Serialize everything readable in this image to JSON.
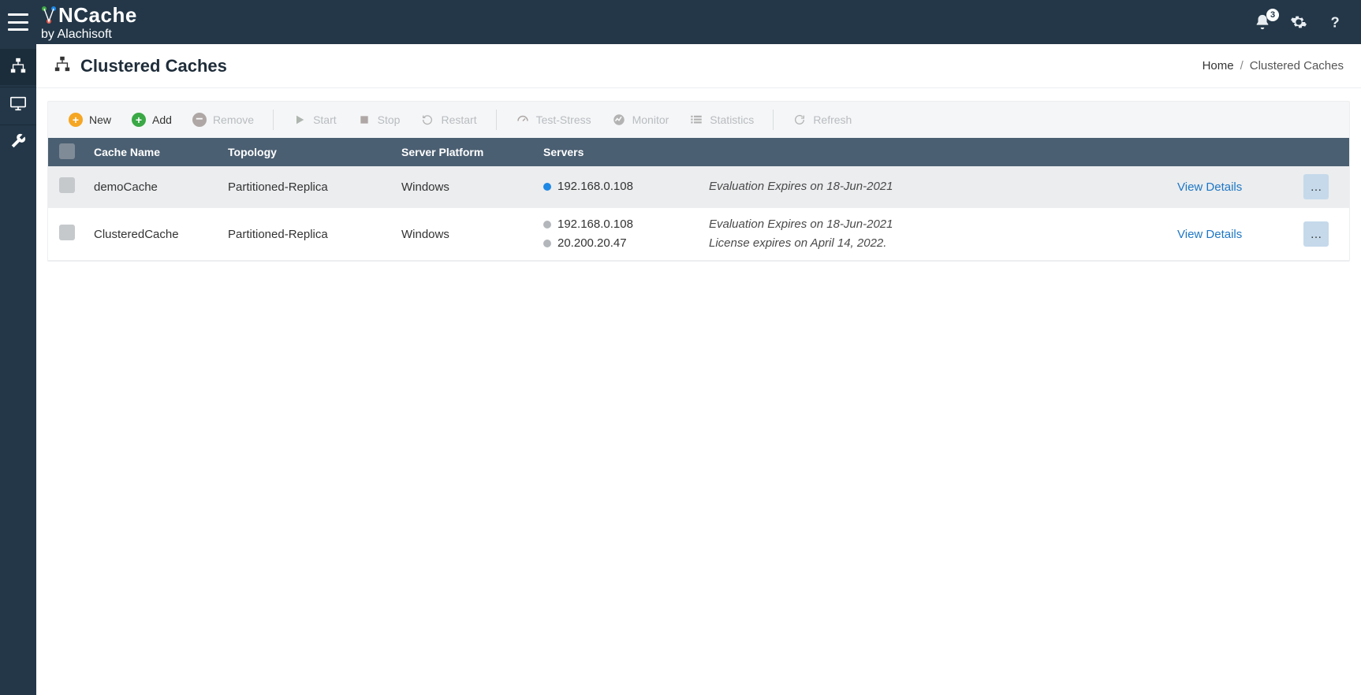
{
  "brand": {
    "name": "NCache",
    "byline": "by Alachisoft"
  },
  "topbar": {
    "notif_count": "3"
  },
  "page": {
    "title": "Clustered Caches"
  },
  "breadcrumb": {
    "home": "Home",
    "current": "Clustered Caches",
    "sep": "/"
  },
  "toolbar": {
    "new_label": "New",
    "add_label": "Add",
    "remove_label": "Remove",
    "start_label": "Start",
    "stop_label": "Stop",
    "restart_label": "Restart",
    "test_label": "Test-Stress",
    "monitor_label": "Monitor",
    "stats_label": "Statistics",
    "refresh_label": "Refresh"
  },
  "columns": {
    "name": "Cache Name",
    "topology": "Topology",
    "platform": "Server Platform",
    "servers": "Servers"
  },
  "rows": [
    {
      "name": "demoCache",
      "topology": "Partitioned-Replica",
      "platform": "Windows",
      "servers": [
        {
          "ip": "192.168.0.108",
          "running": true
        }
      ],
      "status": [
        "Evaluation Expires on 18-Jun-2021"
      ],
      "details": "View Details"
    },
    {
      "name": "ClusteredCache",
      "topology": "Partitioned-Replica",
      "platform": "Windows",
      "servers": [
        {
          "ip": "192.168.0.108",
          "running": false
        },
        {
          "ip": "20.200.20.47",
          "running": false
        }
      ],
      "status": [
        "Evaluation Expires on 18-Jun-2021",
        "License expires on April 14, 2022."
      ],
      "details": "View Details"
    }
  ]
}
